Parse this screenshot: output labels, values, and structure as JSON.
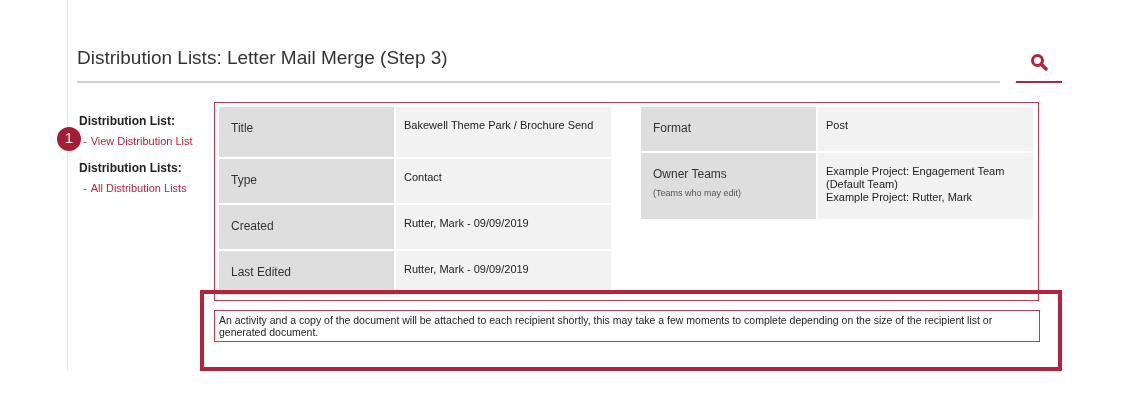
{
  "page_title": "Distribution Lists: Letter Mail Merge (Step 3)",
  "sidebar": [
    {
      "heading": "Distribution List:",
      "links": [
        {
          "bullet": "-",
          "label": "View Distribution List",
          "callout": "1"
        }
      ]
    },
    {
      "heading": "Distribution Lists:",
      "links": [
        {
          "bullet": "-",
          "label": "All Distribution Lists"
        }
      ]
    }
  ],
  "details_left": [
    {
      "label": "Title",
      "value": "Bakewell Theme Park / Brochure Send"
    },
    {
      "label": "Type",
      "value": "Contact"
    },
    {
      "label": "Created",
      "value": "Rutter, Mark - 09/09/2019"
    },
    {
      "label": "Last Edited",
      "value": "Rutter, Mark - 09/09/2019"
    }
  ],
  "details_right": [
    {
      "label": "Format",
      "value": "Post"
    },
    {
      "label": "Owner Teams",
      "sublabel": "(Teams who may edit)",
      "value_lines": [
        "Example Project: Engagement Team (Default Team)",
        "Example Project: Rutter, Mark"
      ]
    }
  ],
  "message": "An activity and a copy of the document will be attached to each recipient shortly, this may take a few moments to complete depending on the size of the recipient list or generated document."
}
